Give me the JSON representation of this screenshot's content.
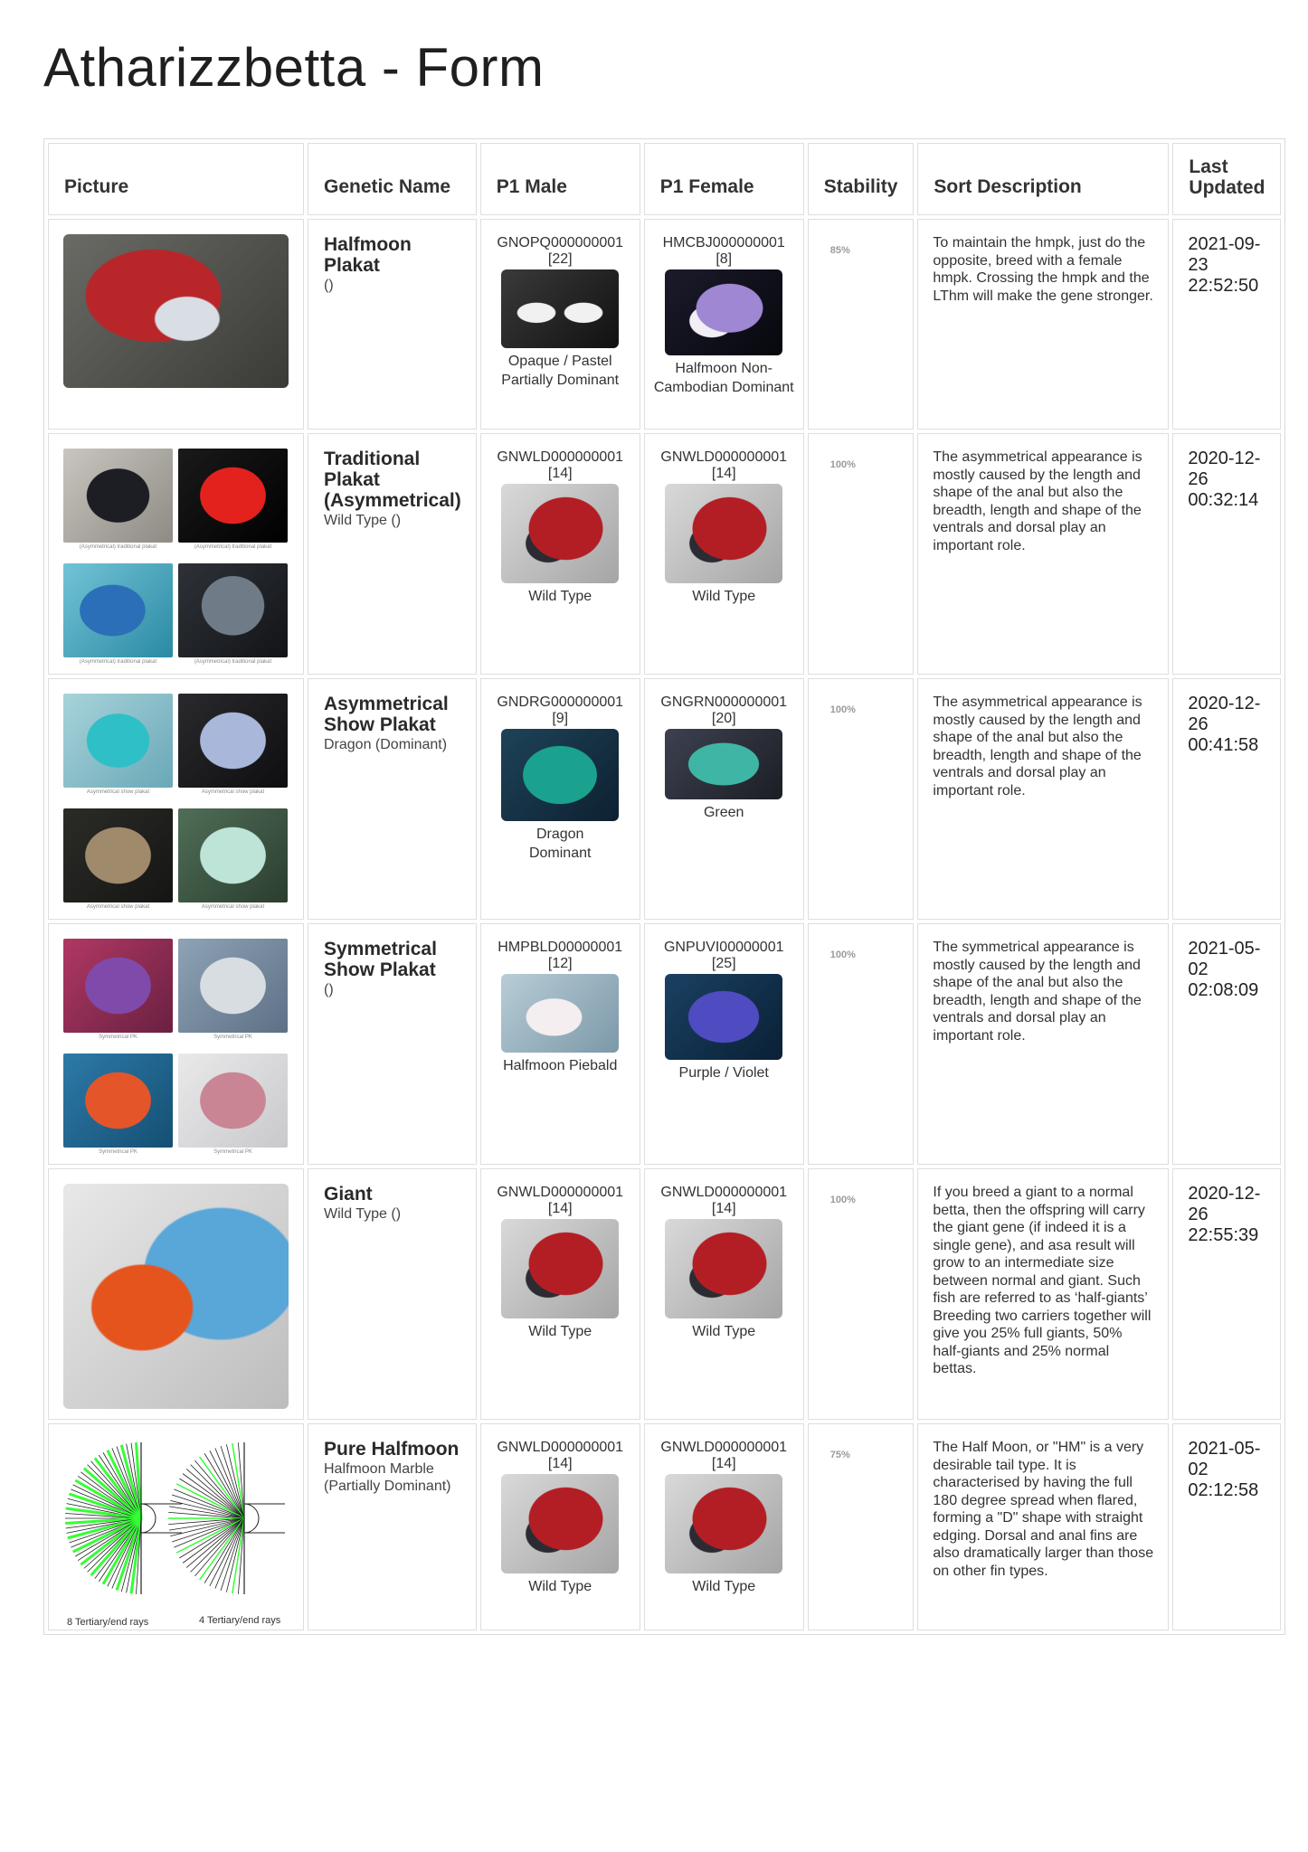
{
  "page": {
    "title": "Atharizzbetta - Form"
  },
  "columns": {
    "picture": "Picture",
    "genetic_name": "Genetic Name",
    "p1_male": "P1 Male",
    "p1_female": "P1 Female",
    "stability": "Stability",
    "sort_description": "Sort Description",
    "last_updated": "Last Updated"
  },
  "rows": [
    {
      "name": "Halfmoon Plakat",
      "sub": "()",
      "male": {
        "code": "GNOPQ000000001",
        "num": "[22]",
        "label": "Opaque / Pastel Partially Dominant"
      },
      "female": {
        "code": "HMCBJ000000001",
        "num": "[8]",
        "label": "Halfmoon Non-Cambodian Dominant"
      },
      "stability": "85%",
      "description": "To maintain the hmpk, just do the opposite, breed with a female hmpk. Crossing the hmpk and the LThm will make the gene stronger.",
      "updated": "2021-09-23 22:52:50"
    },
    {
      "name": "Traditional Plakat (Asymmetrical)",
      "sub": "Wild Type ()",
      "male": {
        "code": "GNWLD000000001",
        "num": "[14]",
        "label": "Wild Type"
      },
      "female": {
        "code": "GNWLD000000001",
        "num": "[14]",
        "label": "Wild Type"
      },
      "stability": "100%",
      "description": "The asymmetrical appearance is mostly caused by the length and shape of the anal but also the breadth, length and shape of the ventrals and dorsal play an important role.",
      "updated": "2020-12-26 00:32:14",
      "captions": [
        "(Asymmetrical) traditional plakat",
        "(Asymmetrical) traditional plakat",
        "(Asymmetrical) traditional plakat",
        "(Asymmetrical) traditional plakat"
      ]
    },
    {
      "name": "Asymmetrical Show Plakat",
      "sub": "Dragon (Dominant)",
      "male": {
        "code": "GNDRG000000001",
        "num": "[9]",
        "label": "Dragon Dominant"
      },
      "female": {
        "code": "GNGRN000000001",
        "num": "[20]",
        "label": "Green"
      },
      "stability": "100%",
      "description": "The asymmetrical appearance is mostly caused by the length and shape of the anal but also the breadth, length and shape of the ventrals and dorsal play an important role.",
      "updated": "2020-12-26 00:41:58",
      "captions": [
        "Asymmetrical show plakat",
        "Asymmetrical show plakat",
        "Asymmetrical show plakat",
        "Asymmetrical show plakat"
      ]
    },
    {
      "name": "Symmetrical Show Plakat",
      "sub": "()",
      "male": {
        "code": "HMPBLD00000001",
        "num": "[12]",
        "label": "Halfmoon Piebald"
      },
      "female": {
        "code": "GNPUVI00000001",
        "num": "[25]",
        "label": "Purple / Violet"
      },
      "stability": "100%",
      "description": "The symmetrical appearance is mostly caused by the length and shape of the anal but also the breadth, length and shape of the ventrals and dorsal play an important role.",
      "updated": "2021-05-02 02:08:09",
      "captions": [
        "Symmetrical PK",
        "Symmetrical PK",
        "Symmetrical PK",
        "Symmetrical PK"
      ]
    },
    {
      "name": "Giant",
      "sub": "Wild Type ()",
      "male": {
        "code": "GNWLD000000001",
        "num": "[14]",
        "label": "Wild Type"
      },
      "female": {
        "code": "GNWLD000000001",
        "num": "[14]",
        "label": "Wild Type"
      },
      "stability": "100%",
      "description": "If you breed a giant to a normal betta, then the offspring will carry the giant gene (if indeed it is a single gene), and asa result will grow to an intermediate size between normal and giant. Such fish are referred to as ‘half-giants’ Breeding two carriers together will give you 25% full giants, 50% half-giants and 25% normal bettas.",
      "updated": "2020-12-26 22:55:39"
    },
    {
      "name": "Pure Halfmoon",
      "sub": "Halfmoon Marble (Partially Dominant)",
      "male": {
        "code": "GNWLD000000001",
        "num": "[14]",
        "label": "Wild Type"
      },
      "female": {
        "code": "GNWLD000000001",
        "num": "[14]",
        "label": "Wild Type"
      },
      "stability": "75%",
      "description": "The Half Moon, or \"HM\" is a very desirable tail type. It is characterised by having the full 180 degree spread when flared, forming a \"D\" shape with straight edging. Dorsal and anal fins are also dramatically larger than those on other fin types.",
      "updated": "2021-05-02 02:12:58",
      "diagram": {
        "left_caption": "8 Tertiary/end rays",
        "right_caption": "4 Tertiary/end rays",
        "accent": "#33ff33"
      }
    }
  ]
}
